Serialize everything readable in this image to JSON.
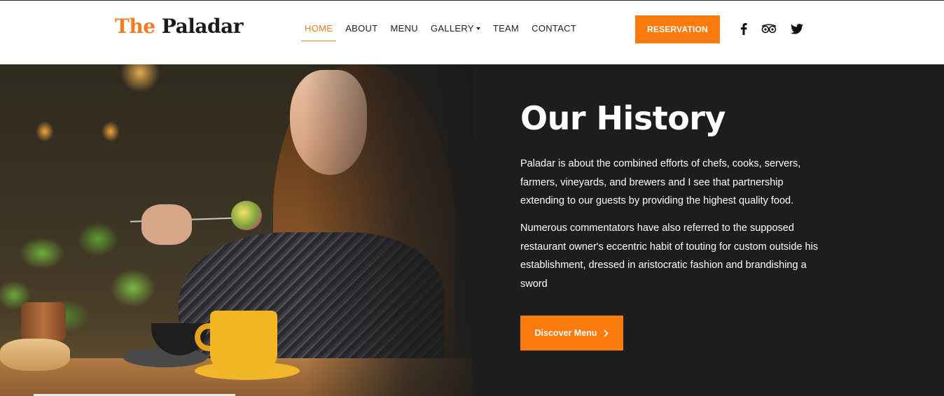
{
  "brand": {
    "logo_accent": "The",
    "logo_main": "Paladar"
  },
  "nav": {
    "items": [
      {
        "label": "HOME"
      },
      {
        "label": "ABOUT"
      },
      {
        "label": "MENU"
      },
      {
        "label": "GALLERY"
      },
      {
        "label": "TEAM"
      },
      {
        "label": "CONTACT"
      }
    ],
    "active": "HOME"
  },
  "header": {
    "reservation_label": "RESERVATION",
    "social": [
      "facebook-icon",
      "tripadvisor-icon",
      "twitter-icon"
    ]
  },
  "hero": {
    "title": "Our History",
    "paragraph1": "Paladar is about the combined efforts of chefs, cooks, servers, farmers, vineyards, and brewers and I see that partnership extending to our guests by providing the highest quality food.",
    "paragraph2": "Numerous commentators have also referred to the supposed restaurant owner's eccentric habit of touting for custom outside his establishment, dressed in aristocratic fashion and brandishing a sword",
    "cta_label": "Discover Menu",
    "image_subject": "woman eating salad in restaurant"
  },
  "colors": {
    "accent": "#fb7b0f",
    "panel": "#1c1d1d",
    "text_dark": "#222222"
  }
}
